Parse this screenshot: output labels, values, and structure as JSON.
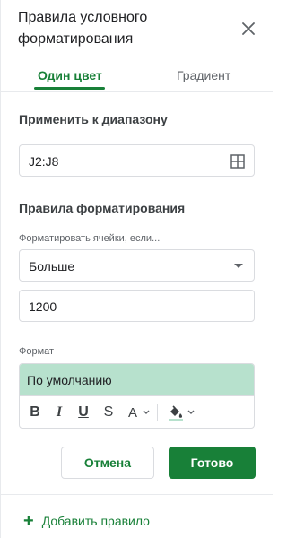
{
  "panel": {
    "title": "Правила условного форматирования"
  },
  "tabs": [
    {
      "label": "Один цвет",
      "selected": true
    },
    {
      "label": "Градиент",
      "selected": false
    }
  ],
  "apply_range": {
    "label": "Применить к диапазону",
    "value": "J2:J8"
  },
  "format_rules": {
    "label": "Правила форматирования",
    "condition_label": "Форматировать ячейки, если...",
    "condition_value": "Больше",
    "value": "1200"
  },
  "format": {
    "label": "Формат",
    "preview_text": "По умолчанию",
    "preview_color": "#b7e1cd",
    "toolbar": {
      "bold": "B",
      "italic": "I",
      "underline": "U",
      "strikethrough": "S",
      "text_color": "A"
    }
  },
  "actions": {
    "cancel": "Отмена",
    "done": "Готово"
  },
  "footer": {
    "add_rule": "Добавить правило"
  },
  "colors": {
    "accent": "#188038",
    "highlight": "#b7e1cd"
  }
}
